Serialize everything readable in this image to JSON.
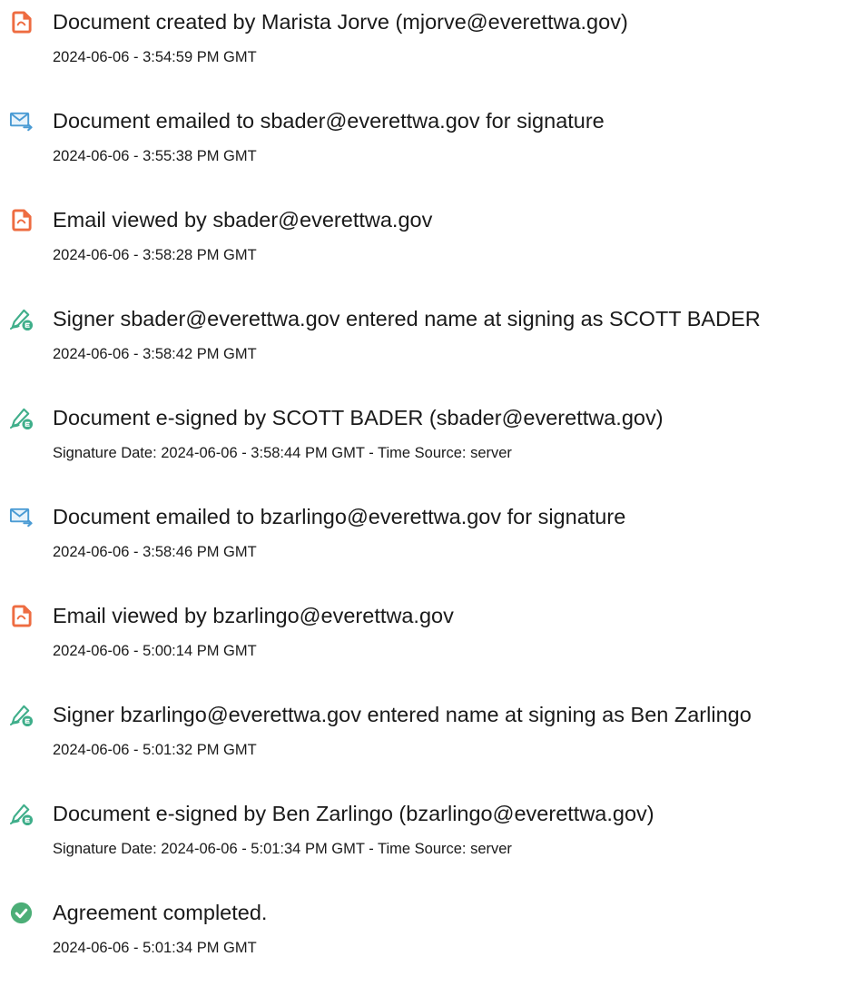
{
  "colors": {
    "document_icon": "#ee6c41",
    "email_icon": "#4a9bd4",
    "sign_icon": "#3fae8a",
    "complete_icon": "#4cae77"
  },
  "events": [
    {
      "icon": "document-icon",
      "title": "Document created by Marista Jorve (mjorve@everettwa.gov)",
      "detail": "2024-06-06 - 3:54:59 PM GMT"
    },
    {
      "icon": "email-icon",
      "title": "Document emailed to sbader@everettwa.gov for signature",
      "detail": "2024-06-06 - 3:55:38 PM GMT"
    },
    {
      "icon": "document-icon",
      "title": "Email viewed by sbader@everettwa.gov",
      "detail": "2024-06-06 - 3:58:28 PM GMT"
    },
    {
      "icon": "sign-icon",
      "title": "Signer sbader@everettwa.gov entered name at signing as SCOTT BADER",
      "detail": "2024-06-06 - 3:58:42 PM GMT"
    },
    {
      "icon": "sign-icon",
      "title": "Document e-signed by SCOTT BADER (sbader@everettwa.gov)",
      "detail": "Signature Date: 2024-06-06 - 3:58:44 PM GMT - Time Source: server"
    },
    {
      "icon": "email-icon",
      "title": "Document emailed to bzarlingo@everettwa.gov for signature",
      "detail": "2024-06-06 - 3:58:46 PM GMT"
    },
    {
      "icon": "document-icon",
      "title": "Email viewed by bzarlingo@everettwa.gov",
      "detail": "2024-06-06 - 5:00:14 PM GMT"
    },
    {
      "icon": "sign-icon",
      "title": "Signer bzarlingo@everettwa.gov entered name at signing as Ben Zarlingo",
      "detail": "2024-06-06 - 5:01:32 PM GMT"
    },
    {
      "icon": "sign-icon",
      "title": "Document e-signed by Ben Zarlingo (bzarlingo@everettwa.gov)",
      "detail": "Signature Date: 2024-06-06 - 5:01:34 PM GMT - Time Source: server"
    },
    {
      "icon": "check-circle-icon",
      "title": "Agreement completed.",
      "detail": "2024-06-06 - 5:01:34 PM GMT"
    }
  ]
}
